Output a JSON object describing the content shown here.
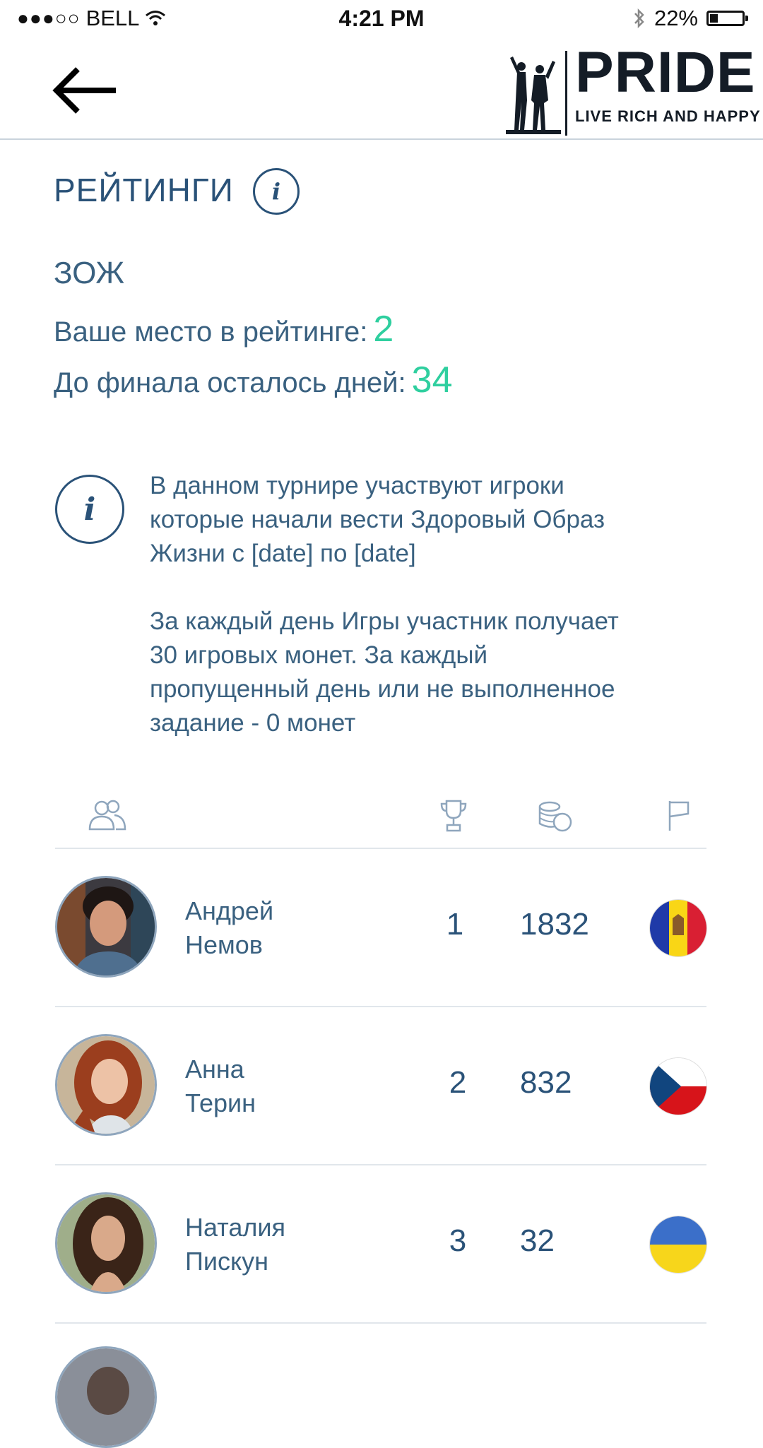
{
  "status_bar": {
    "signal_dots": "●●●○○",
    "carrier": "BELL",
    "wifi_icon": "wifi-icon",
    "time": "4:21 PM",
    "bluetooth_icon": "bluetooth-icon",
    "battery_percent": "22%",
    "battery_level": 0.22
  },
  "header": {
    "back_icon": "arrow-left-icon",
    "logo_name": "PRIDE",
    "logo_tagline": "LIVE RICH AND HAPPY"
  },
  "page": {
    "title": "РЕЙТИНГИ",
    "category": "ЗОЖ",
    "place_label": "Ваше место в рейтинге:",
    "place_value": "2",
    "days_label": "До финала осталось дней:",
    "days_value": "34",
    "notice_p1_l1": "В данном турнире участвуют игроки",
    "notice_p1_l2": "которые начали вести Здоровый Образ",
    "notice_p1_l3": "Жизни с [date] по [date]",
    "notice_p2_l1": "За каждый день Игры участник получает",
    "notice_p2_l2": "30 игровых монет. За каждый",
    "notice_p2_l3": "пропущенный день или не выполненное",
    "notice_p2_l4": "задание - 0 монет"
  },
  "table": {
    "header_icons": [
      "users-icon",
      "trophy-icon",
      "coins-icon",
      "flag-icon"
    ],
    "rows": [
      {
        "first": "Андрей",
        "last": "Немов",
        "place": "1",
        "coins": "1832",
        "country": "moldova-flag"
      },
      {
        "first": "Анна",
        "last": "Терин",
        "place": "2",
        "coins": "832",
        "country": "czech-flag"
      },
      {
        "first": "Наталия",
        "last": "Пискун",
        "place": "3",
        "coins": "32",
        "country": "ukraine-flag"
      }
    ]
  },
  "colors": {
    "primary_text": "#2a5278",
    "accent_green": "#2fcf9f",
    "divider": "#e1e6eb",
    "icon_light": "#8fa6bd"
  }
}
